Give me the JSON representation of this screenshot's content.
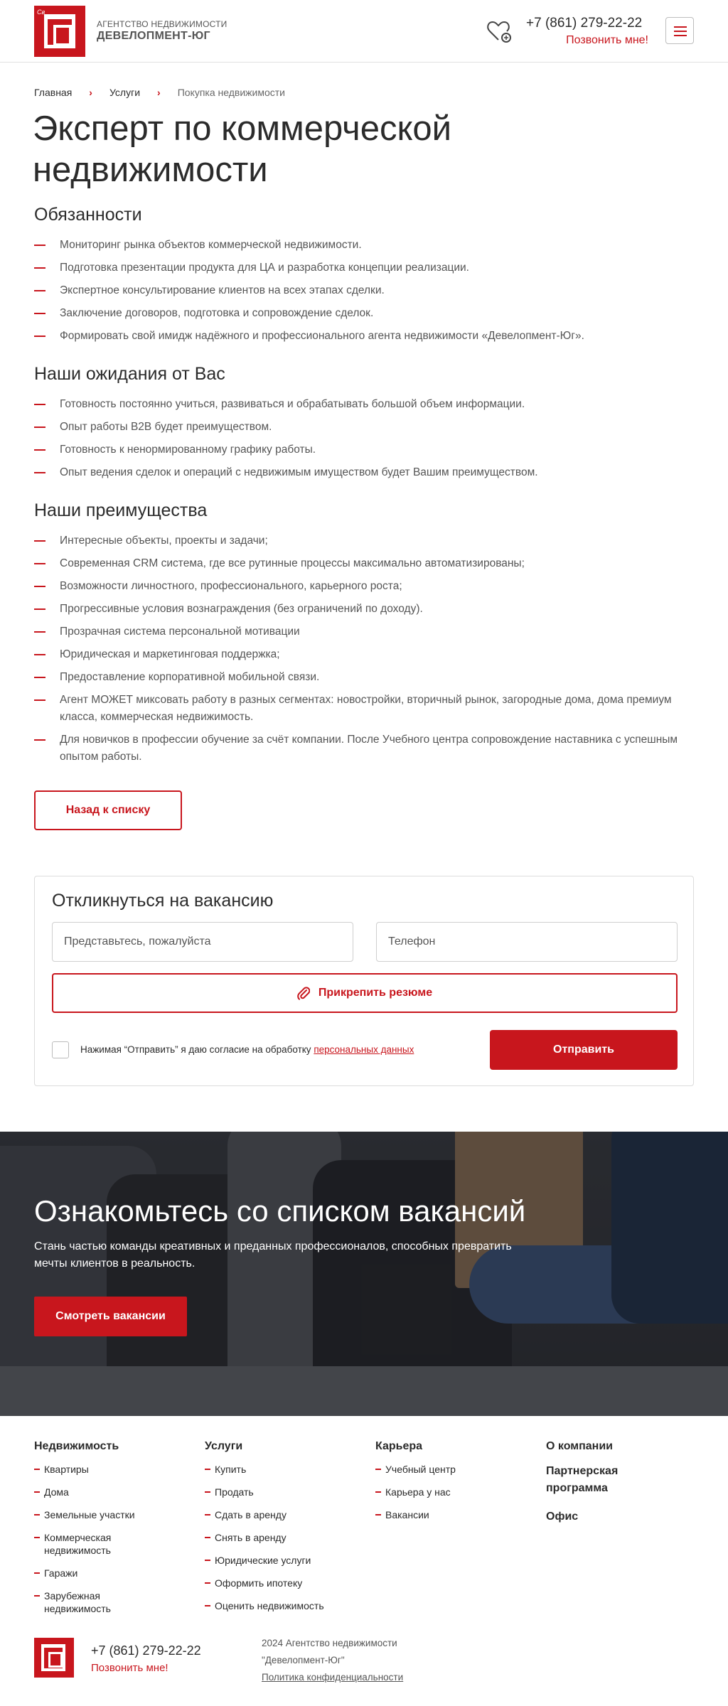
{
  "header": {
    "logo_caption": "Св",
    "brand_top": "АГЕНТСТВО НЕДВИЖИМОСТИ",
    "brand_bottom": "ДЕВЕЛОПМЕНТ-ЮГ",
    "phone": "+7 (861) 279-22-22",
    "callme": "Позвонить мне!"
  },
  "breadcrumbs": [
    "Главная",
    "Услуги",
    "Покупка недвижимости"
  ],
  "page_title": "Эксперт по коммерческой недвижимости",
  "sections": [
    {
      "title": "Обязанности",
      "items": [
        "Мониторинг рынка объектов коммерческой недвижимости.",
        "Подготовка презентации продукта для ЦА и разработка концепции реализации.",
        "Экспертное консультирование клиентов на всех этапах сделки.",
        "Заключение договоров, подготовка и сопровождение сделок.",
        "Формировать свой имидж надёжного и профессионального агента недвижимости «Девелопмент-Юг»."
      ]
    },
    {
      "title": "Наши ожидания от Вас",
      "items": [
        "Готовность постоянно учиться, развиваться и обрабатывать большой объем информации.",
        "Опыт работы B2B будет преимуществом.",
        "Готовность к ненормированному графику работы.",
        "Опыт ведения сделок и операций с недвижимым имуществом будет Вашим преимуществом."
      ]
    },
    {
      "title": "Наши преимущества",
      "items": [
        "Интересные объекты, проекты и задачи;",
        "Современная CRM система, где все рутинные процессы максимально автоматизированы;",
        "Возможности личностного, профессионального, карьерного роста;",
        "Прогрессивные условия вознаграждения (без ограничений по доходу).",
        "Прозрачная система персональной мотивации",
        "Юридическая и маркетинговая поддержка;",
        "Предоставление корпоративной мобильной связи.",
        "Агент МОЖЕТ миксовать работу в разных сегментах: новостройки, вторичный рынок, загородные дома, дома премиум класса, коммерческая недвижимость.",
        "Для новичков в профессии обучение за счёт компании. После Учебного центра сопровождение наставника с успешным опытом работы."
      ]
    }
  ],
  "back_button": "Назад к списку",
  "form": {
    "title": "Откликнуться на вакансию",
    "name_placeholder": "Представьтесь, пожалуйста",
    "phone_placeholder": "Телефон",
    "attach_label": "Прикрепить резюме",
    "consent_text": "Нажимая “Отправить” я даю согласие на обработку ",
    "consent_link": "персональных данных",
    "submit_label": "Отправить"
  },
  "hero": {
    "title": "Ознакомьтесь со списком вакансий",
    "subtitle": "Стань частью команды креативных и преданных профессионалов, способных превратить мечты клиентов в реальность.",
    "button": "Смотреть вакансии"
  },
  "footer": {
    "columns": [
      {
        "title": "Недвижимость",
        "items": [
          "Квартиры",
          "Дома",
          "Земельные участки",
          "Коммерческая недвижимость",
          "Гаражи",
          "Зарубежная недвижимость"
        ]
      },
      {
        "title": "Услуги",
        "items": [
          "Купить",
          "Продать",
          "Сдать в аренду",
          "Снять в аренду",
          "Юридические услуги",
          "Оформить ипотеку",
          "Оценить недвижимость"
        ]
      },
      {
        "title": "Карьера",
        "items": [
          "Учебный центр",
          "Карьера у нас",
          "Вакансии"
        ]
      },
      {
        "title": "О компании",
        "plain": [
          "Партнерская программа",
          "Офис"
        ]
      }
    ],
    "phone": "+7 (861) 279-22-22",
    "callme": "Позвонить мне!",
    "copyright_line1": "2024 Агентство недвижимости",
    "copyright_line2": "\"Девелопмент-Юг\"",
    "privacy": "Политика конфиденциальности"
  },
  "colors": {
    "accent": "#c8161d",
    "text": "#2b2b2b",
    "muted": "#555555"
  },
  "icons": {
    "favorites": "heart-icon",
    "menu": "hamburger-icon",
    "attach": "paperclip-icon",
    "breadcrumb_separator": "chevron-right-icon"
  }
}
